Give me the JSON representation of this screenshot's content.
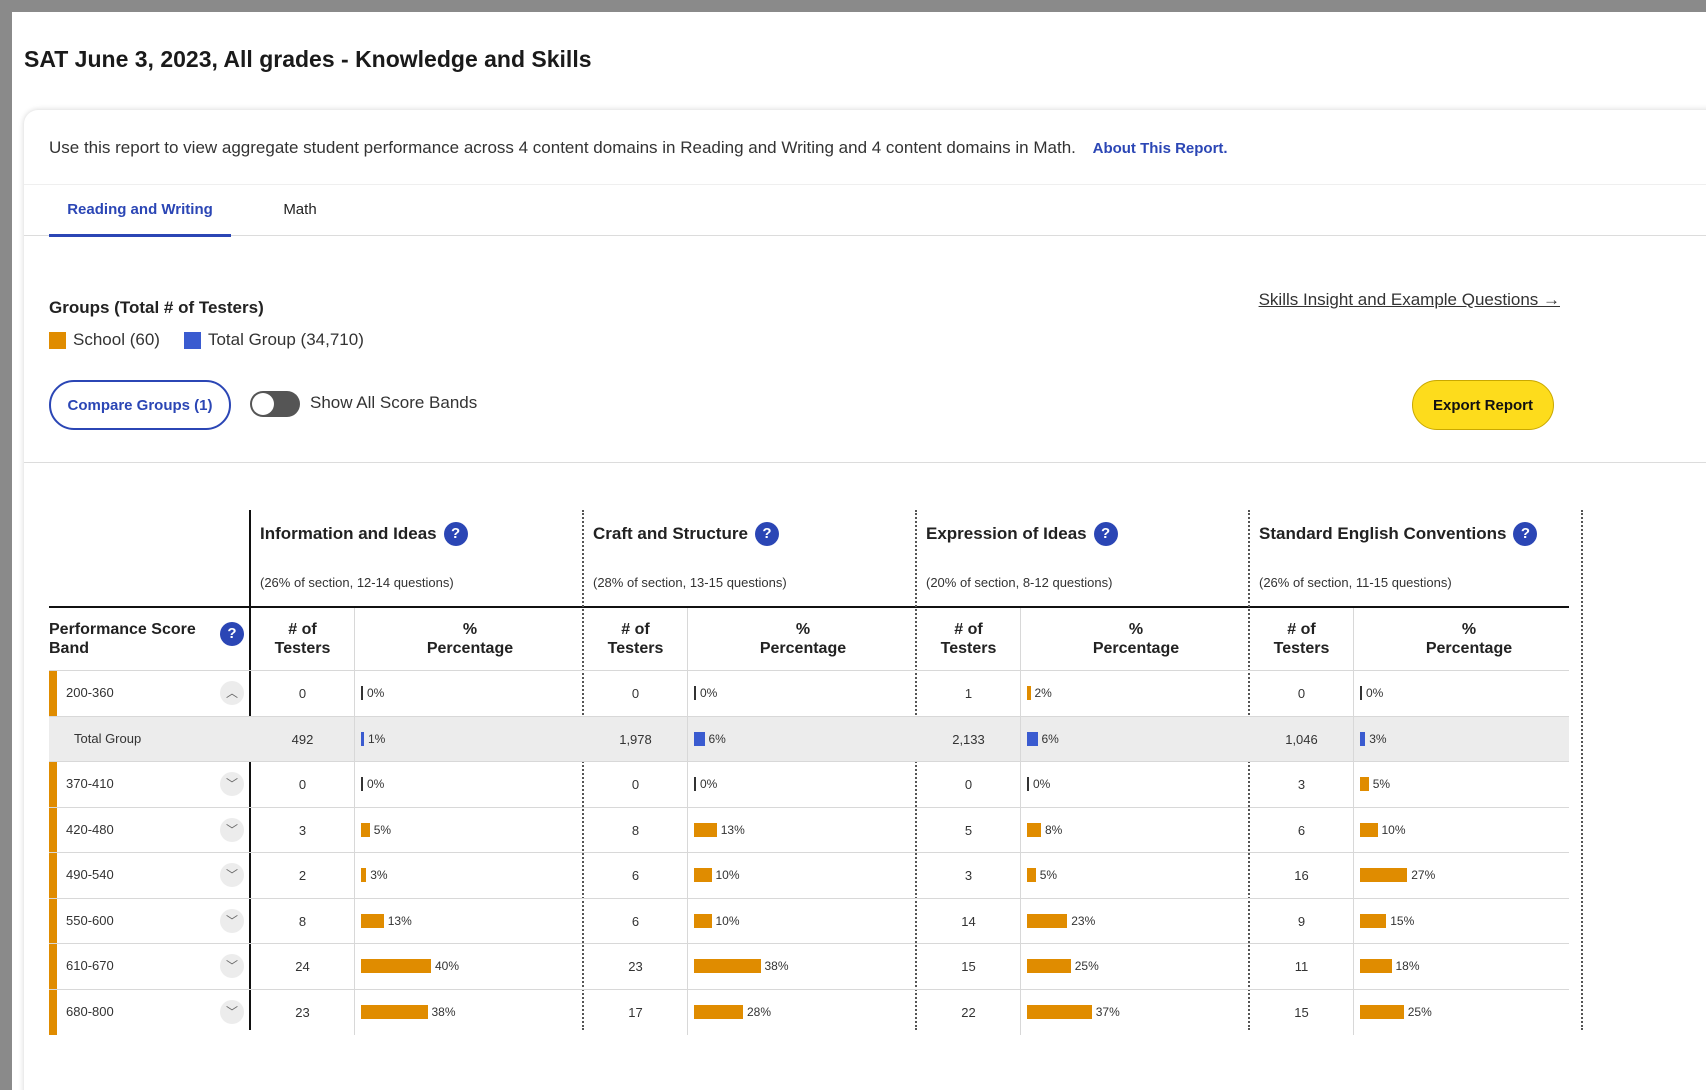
{
  "page": {
    "title": "SAT June 3, 2023, All grades - Knowledge and Skills",
    "intro": "Use this report to view aggregate student performance across 4 content domains in Reading and Writing and 4 content domains in Math.",
    "about_link": "About This Report."
  },
  "tabs": [
    {
      "label": "Reading and Writing",
      "active": true
    },
    {
      "label": "Math",
      "active": false
    }
  ],
  "groups": {
    "title": "Groups (Total # of Testers)",
    "items": [
      {
        "label": "School (60)",
        "color": "#e08c00"
      },
      {
        "label": "Total Group (34,710)",
        "color": "#3a5bd0"
      }
    ]
  },
  "controls": {
    "skills_link": "Skills Insight and Example Questions →",
    "compare_button": "Compare Groups (1)",
    "toggle_label": "Show All Score Bands",
    "toggle_on": false,
    "export_button": "Export Report"
  },
  "table": {
    "band_header": "Performance Score Band",
    "count_header_1": "# of",
    "count_header_2": "Testers",
    "pct_header_1": "%",
    "pct_header_2": "Percentage",
    "domains": [
      {
        "name": "Information and Ideas",
        "sub": "(26% of section, 12-14 questions)"
      },
      {
        "name": "Craft and Structure",
        "sub": "(28% of section, 13-15 questions)"
      },
      {
        "name": "Expression of Ideas",
        "sub": "(20% of section, 8-12 questions)"
      },
      {
        "name": "Standard English Conventions",
        "sub": "(26% of section, 11-15 questions)"
      }
    ],
    "rows": [
      {
        "band": "200-360",
        "type": "school",
        "expanded": true,
        "cells": [
          {
            "count": "0",
            "pct": 0,
            "pct_label": "0%"
          },
          {
            "count": "0",
            "pct": 0,
            "pct_label": "0%"
          },
          {
            "count": "1",
            "pct": 2,
            "pct_label": "2%"
          },
          {
            "count": "0",
            "pct": 0,
            "pct_label": "0%"
          }
        ]
      },
      {
        "band": "Total Group",
        "type": "total",
        "cells": [
          {
            "count": "492",
            "pct": 1,
            "pct_label": "1%"
          },
          {
            "count": "1,978",
            "pct": 6,
            "pct_label": "6%"
          },
          {
            "count": "2,133",
            "pct": 6,
            "pct_label": "6%"
          },
          {
            "count": "1,046",
            "pct": 3,
            "pct_label": "3%"
          }
        ]
      },
      {
        "band": "370-410",
        "type": "school",
        "expanded": false,
        "cells": [
          {
            "count": "0",
            "pct": 0,
            "pct_label": "0%"
          },
          {
            "count": "0",
            "pct": 0,
            "pct_label": "0%"
          },
          {
            "count": "0",
            "pct": 0,
            "pct_label": "0%"
          },
          {
            "count": "3",
            "pct": 5,
            "pct_label": "5%"
          }
        ]
      },
      {
        "band": "420-480",
        "type": "school",
        "expanded": false,
        "cells": [
          {
            "count": "3",
            "pct": 5,
            "pct_label": "5%"
          },
          {
            "count": "8",
            "pct": 13,
            "pct_label": "13%"
          },
          {
            "count": "5",
            "pct": 8,
            "pct_label": "8%"
          },
          {
            "count": "6",
            "pct": 10,
            "pct_label": "10%"
          }
        ]
      },
      {
        "band": "490-540",
        "type": "school",
        "expanded": false,
        "cells": [
          {
            "count": "2",
            "pct": 3,
            "pct_label": "3%"
          },
          {
            "count": "6",
            "pct": 10,
            "pct_label": "10%"
          },
          {
            "count": "3",
            "pct": 5,
            "pct_label": "5%"
          },
          {
            "count": "16",
            "pct": 27,
            "pct_label": "27%"
          }
        ]
      },
      {
        "band": "550-600",
        "type": "school",
        "expanded": false,
        "cells": [
          {
            "count": "8",
            "pct": 13,
            "pct_label": "13%"
          },
          {
            "count": "6",
            "pct": 10,
            "pct_label": "10%"
          },
          {
            "count": "14",
            "pct": 23,
            "pct_label": "23%"
          },
          {
            "count": "9",
            "pct": 15,
            "pct_label": "15%"
          }
        ]
      },
      {
        "band": "610-670",
        "type": "school",
        "expanded": false,
        "cells": [
          {
            "count": "24",
            "pct": 40,
            "pct_label": "40%"
          },
          {
            "count": "23",
            "pct": 38,
            "pct_label": "38%"
          },
          {
            "count": "15",
            "pct": 25,
            "pct_label": "25%"
          },
          {
            "count": "11",
            "pct": 18,
            "pct_label": "18%"
          }
        ]
      },
      {
        "band": "680-800",
        "type": "school",
        "expanded": false,
        "cells": [
          {
            "count": "23",
            "pct": 38,
            "pct_label": "38%"
          },
          {
            "count": "17",
            "pct": 28,
            "pct_label": "28%"
          },
          {
            "count": "22",
            "pct": 37,
            "pct_label": "37%"
          },
          {
            "count": "15",
            "pct": 25,
            "pct_label": "25%"
          }
        ]
      }
    ]
  }
}
